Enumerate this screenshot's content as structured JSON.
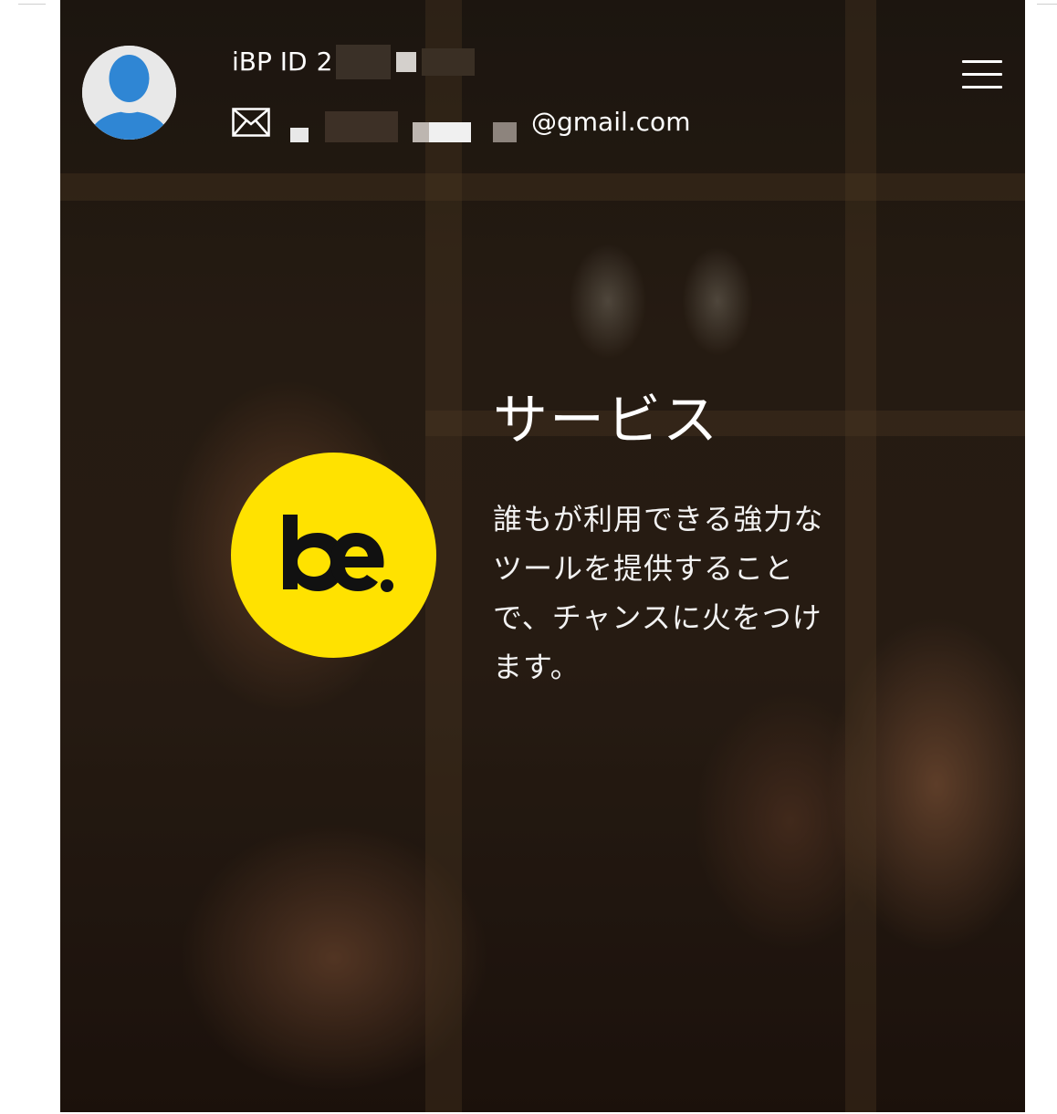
{
  "user": {
    "id_label": "iBP ID",
    "id_prefix": "2",
    "email_suffix": "@gmail.com"
  },
  "icons": {
    "avatar": "user-avatar-icon",
    "mail": "envelope-icon",
    "menu": "hamburger-menu-icon"
  },
  "logo": {
    "text": "be.",
    "color": "#ffe200"
  },
  "service": {
    "title": "サービス",
    "description_lines": [
      "誰もが利用できる強力な",
      "ツールを提供すること",
      "で、チャンスに火をつけ",
      "ます。"
    ]
  },
  "colors": {
    "avatar_blue": "#2f86d4",
    "logo_yellow": "#ffe200",
    "text": "#ffffff"
  }
}
